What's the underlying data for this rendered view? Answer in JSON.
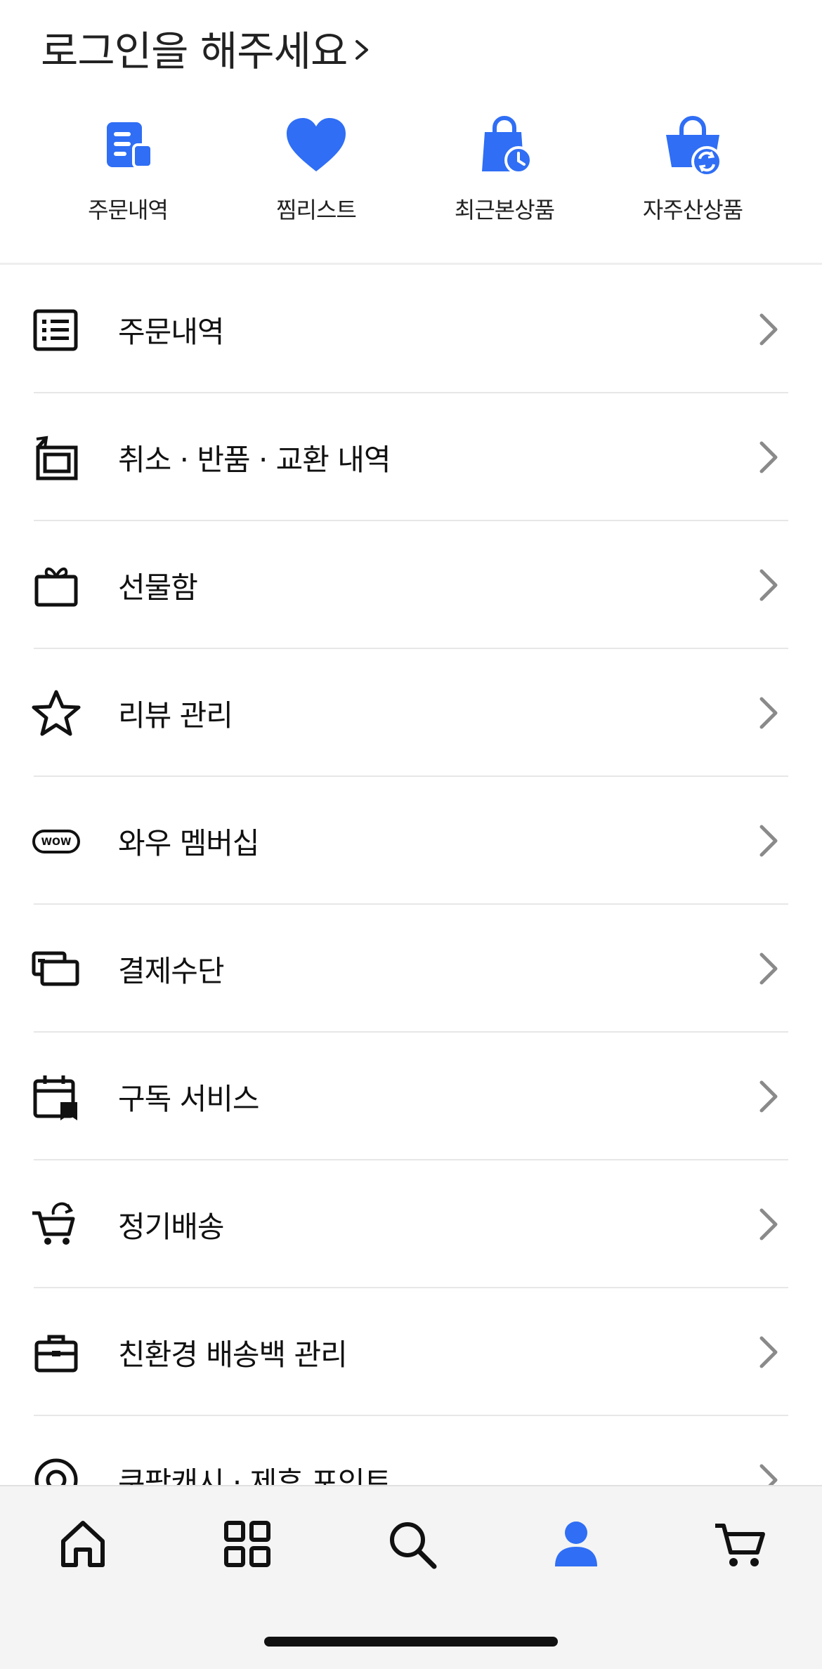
{
  "header": {
    "login_prompt": "로그인을 해주세요"
  },
  "quick_actions": [
    {
      "label": "주문내역",
      "icon": "order-list-icon"
    },
    {
      "label": "찜리스트",
      "icon": "heart-icon"
    },
    {
      "label": "최근본상품",
      "icon": "recent-bag-icon"
    },
    {
      "label": "자주산상품",
      "icon": "repeat-basket-icon"
    }
  ],
  "menu": [
    {
      "label": "주문내역",
      "icon": "list-icon"
    },
    {
      "label": "취소 · 반품 · 교환 내역",
      "icon": "return-icon"
    },
    {
      "label": "선물함",
      "icon": "gift-icon"
    },
    {
      "label": "리뷰 관리",
      "icon": "star-icon"
    },
    {
      "label": "와우 멤버십",
      "icon": "wow-icon"
    },
    {
      "label": "결제수단",
      "icon": "card-icon"
    },
    {
      "label": "구독 서비스",
      "icon": "calendar-icon"
    },
    {
      "label": "정기배송",
      "icon": "cart-cycle-icon"
    },
    {
      "label": "친환경 배송백 관리",
      "icon": "bag-icon"
    },
    {
      "label": "쿠팡캐시 · 제휴 포인트",
      "icon": "coin-icon"
    }
  ],
  "wow_badge_text": "WOW",
  "tabbar": [
    {
      "name": "home",
      "icon": "home-icon",
      "active": false
    },
    {
      "name": "categories",
      "icon": "grid-icon",
      "active": false
    },
    {
      "name": "search",
      "icon": "search-icon",
      "active": false
    },
    {
      "name": "my",
      "icon": "person-icon",
      "active": true
    },
    {
      "name": "cart",
      "icon": "cart-icon",
      "active": false
    }
  ],
  "colors": {
    "accent": "#2f6ef5",
    "text": "#111111",
    "chevron": "#8a8a8a",
    "divider": "#e7e7e7"
  }
}
